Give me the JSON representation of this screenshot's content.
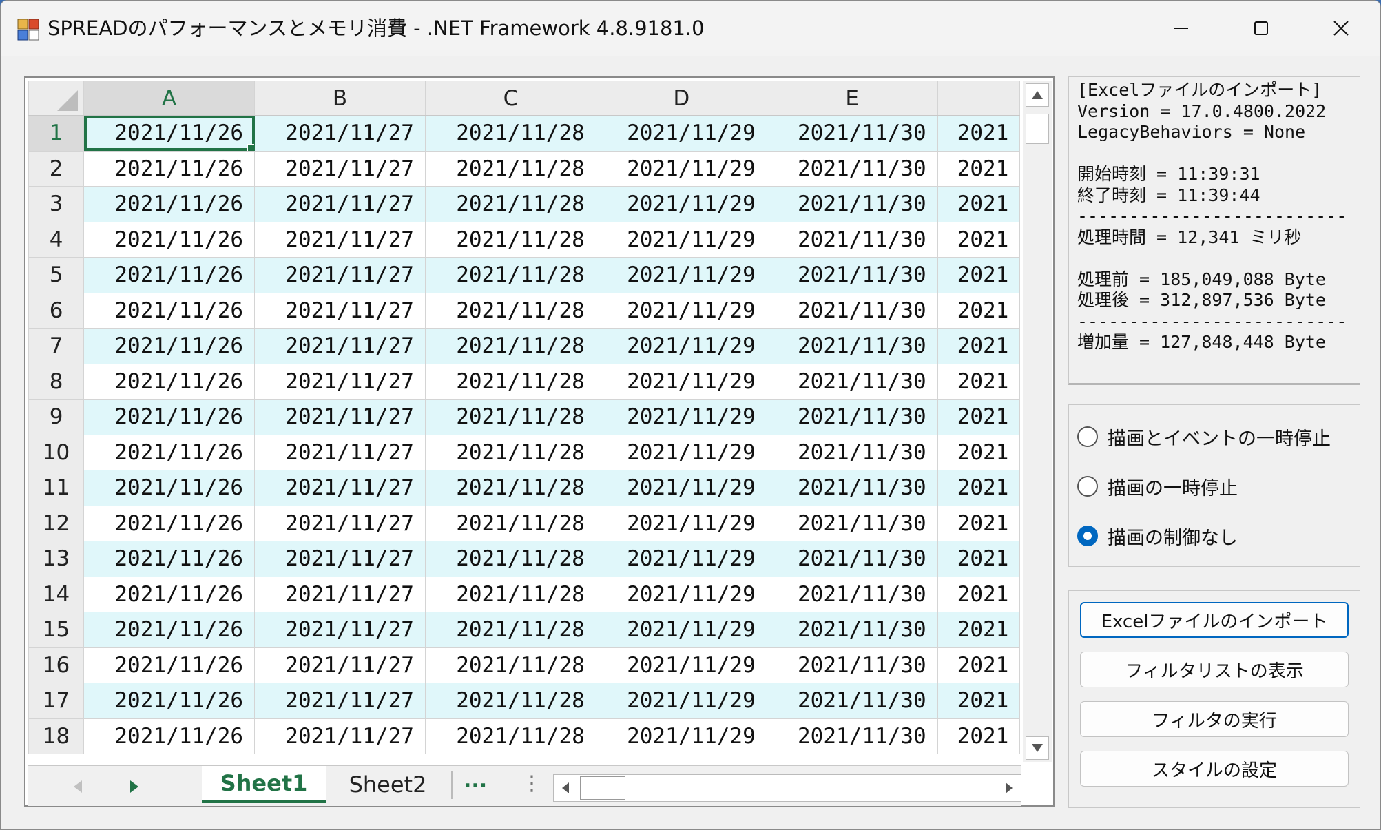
{
  "window": {
    "title": "SPREADのパフォーマンスとメモリ消費 - .NET Framework 4.8.9181.0"
  },
  "grid": {
    "columns": [
      "A",
      "B",
      "C",
      "D",
      "E",
      ""
    ],
    "rows": [
      {
        "num": "1",
        "cells": [
          "2021/11/26",
          "2021/11/27",
          "2021/11/28",
          "2021/11/29",
          "2021/11/30",
          "2021"
        ]
      },
      {
        "num": "2",
        "cells": [
          "2021/11/26",
          "2021/11/27",
          "2021/11/28",
          "2021/11/29",
          "2021/11/30",
          "2021"
        ]
      },
      {
        "num": "3",
        "cells": [
          "2021/11/26",
          "2021/11/27",
          "2021/11/28",
          "2021/11/29",
          "2021/11/30",
          "2021"
        ]
      },
      {
        "num": "4",
        "cells": [
          "2021/11/26",
          "2021/11/27",
          "2021/11/28",
          "2021/11/29",
          "2021/11/30",
          "2021"
        ]
      },
      {
        "num": "5",
        "cells": [
          "2021/11/26",
          "2021/11/27",
          "2021/11/28",
          "2021/11/29",
          "2021/11/30",
          "2021"
        ]
      },
      {
        "num": "6",
        "cells": [
          "2021/11/26",
          "2021/11/27",
          "2021/11/28",
          "2021/11/29",
          "2021/11/30",
          "2021"
        ]
      },
      {
        "num": "7",
        "cells": [
          "2021/11/26",
          "2021/11/27",
          "2021/11/28",
          "2021/11/29",
          "2021/11/30",
          "2021"
        ]
      },
      {
        "num": "8",
        "cells": [
          "2021/11/26",
          "2021/11/27",
          "2021/11/28",
          "2021/11/29",
          "2021/11/30",
          "2021"
        ]
      },
      {
        "num": "9",
        "cells": [
          "2021/11/26",
          "2021/11/27",
          "2021/11/28",
          "2021/11/29",
          "2021/11/30",
          "2021"
        ]
      },
      {
        "num": "10",
        "cells": [
          "2021/11/26",
          "2021/11/27",
          "2021/11/28",
          "2021/11/29",
          "2021/11/30",
          "2021"
        ]
      },
      {
        "num": "11",
        "cells": [
          "2021/11/26",
          "2021/11/27",
          "2021/11/28",
          "2021/11/29",
          "2021/11/30",
          "2021"
        ]
      },
      {
        "num": "12",
        "cells": [
          "2021/11/26",
          "2021/11/27",
          "2021/11/28",
          "2021/11/29",
          "2021/11/30",
          "2021"
        ]
      },
      {
        "num": "13",
        "cells": [
          "2021/11/26",
          "2021/11/27",
          "2021/11/28",
          "2021/11/29",
          "2021/11/30",
          "2021"
        ]
      },
      {
        "num": "14",
        "cells": [
          "2021/11/26",
          "2021/11/27",
          "2021/11/28",
          "2021/11/29",
          "2021/11/30",
          "2021"
        ]
      },
      {
        "num": "15",
        "cells": [
          "2021/11/26",
          "2021/11/27",
          "2021/11/28",
          "2021/11/29",
          "2021/11/30",
          "2021"
        ]
      },
      {
        "num": "16",
        "cells": [
          "2021/11/26",
          "2021/11/27",
          "2021/11/28",
          "2021/11/29",
          "2021/11/30",
          "2021"
        ]
      },
      {
        "num": "17",
        "cells": [
          "2021/11/26",
          "2021/11/27",
          "2021/11/28",
          "2021/11/29",
          "2021/11/30",
          "2021"
        ]
      },
      {
        "num": "18",
        "cells": [
          "2021/11/26",
          "2021/11/27",
          "2021/11/28",
          "2021/11/29",
          "2021/11/30",
          "2021"
        ]
      }
    ],
    "active_cell": "A1",
    "alt_row_color": "#e0f7fa",
    "selection_color": "#217346"
  },
  "sheets": {
    "tabs": [
      "Sheet1",
      "Sheet2"
    ],
    "active": "Sheet1",
    "more": "..."
  },
  "info": {
    "text": "[Excelファイルのインポート]\nVersion = 17.0.4800.2022\nLegacyBehaviors = None\n\n開始時刻 = 11:39:31\n終了時刻 = 11:39:44\n--------------------------\n処理時間 = 12,341 ミリ秒\n\n処理前 = 185,049,088 Byte\n処理後 = 312,897,536 Byte\n--------------------------\n増加量 = 127,848,448 Byte"
  },
  "options": {
    "radios": [
      {
        "label": "描画とイベントの一時停止",
        "checked": false
      },
      {
        "label": "描画の一時停止",
        "checked": false
      },
      {
        "label": "描画の制御なし",
        "checked": true
      }
    ]
  },
  "actions": {
    "import_label": "Excelファイルのインポート",
    "filter_list_label": "フィルタリストの表示",
    "run_filter_label": "フィルタの実行",
    "style_label": "スタイルの設定"
  },
  "icons": {
    "app": "spread-app-icon",
    "minimize": "minimize-icon",
    "maximize": "maximize-icon",
    "close": "close-icon"
  }
}
